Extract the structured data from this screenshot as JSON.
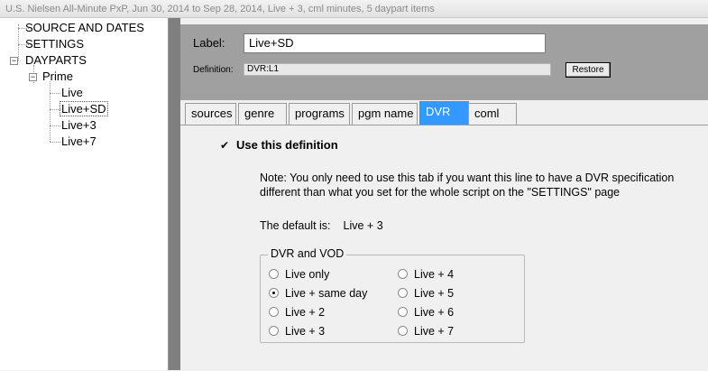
{
  "window": {
    "title": "U.S. Nielsen All-Minute PxP, Jun 30, 2014 to Sep 28, 2014, Live + 3, cml minutes, 5 daypart items"
  },
  "tree": {
    "source_and_dates": "SOURCE AND DATES",
    "settings": "SETTINGS",
    "dayparts": "DAYPARTS",
    "prime": "Prime",
    "children": [
      "Live",
      "Live+SD",
      "Live+3",
      "Live+7"
    ],
    "selected": "Live+SD"
  },
  "header": {
    "label_caption": "Label:",
    "label_value": "Live+SD",
    "definition_caption": "Definition:",
    "definition_value": "DVR:L1",
    "restore_label": "Restore"
  },
  "tabs": [
    "sources",
    "genre",
    "programs",
    "pgm name",
    "DVR",
    "coml"
  ],
  "active_tab": "DVR",
  "dvr_panel": {
    "use_definition_label": "Use this definition",
    "use_definition_checked": true,
    "note": "Note: You only need to use this tab if you want this line to have a DVR specification different than what you set for the whole script on the \"SETTINGS\" page",
    "default_caption": "The default is:",
    "default_value": "Live + 3",
    "group_title": "DVR and VOD",
    "options": [
      "Live only",
      "Live + same day",
      "Live + 2",
      "Live + 3",
      "Live + 4",
      "Live + 5",
      "Live + 6",
      "Live + 7"
    ],
    "selected_option": "Live + same day"
  }
}
